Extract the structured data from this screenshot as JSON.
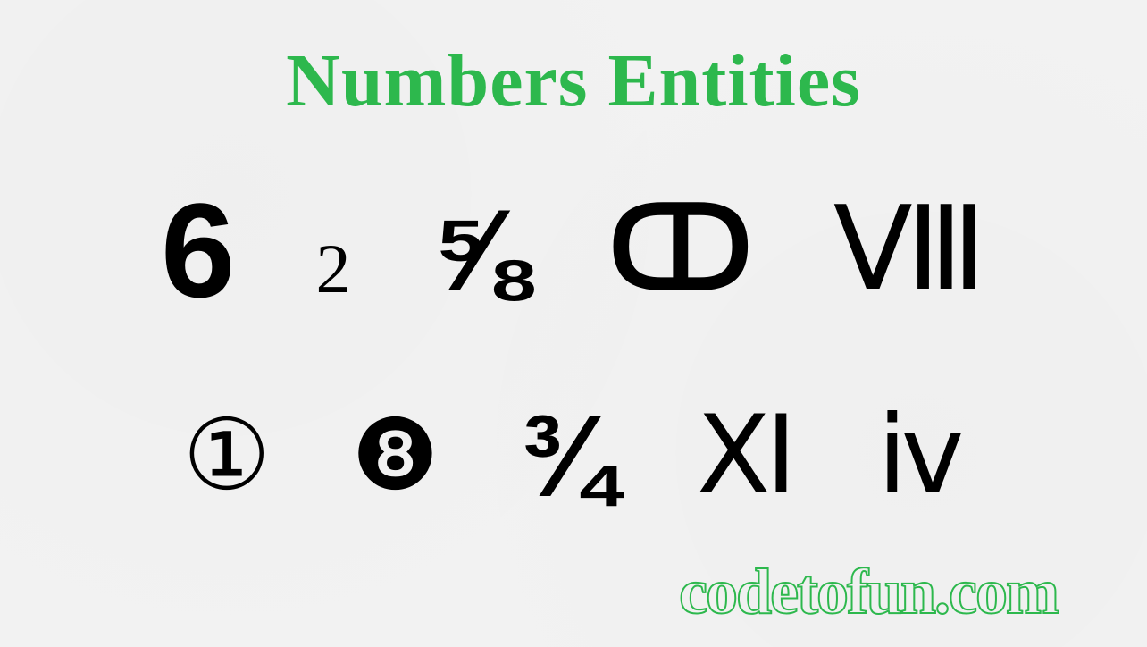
{
  "heading": "Numbers Entities",
  "row1": {
    "items": [
      {
        "value": "6",
        "style": "bold"
      },
      {
        "value": "2",
        "style": "serif-small"
      },
      {
        "value": "⅝",
        "style": "bold"
      },
      {
        "value": "ↀ",
        "style": "serif-bold"
      },
      {
        "value": "Ⅷ",
        "style": "serif"
      }
    ]
  },
  "row2": {
    "items": [
      {
        "value": "①",
        "style": "serif"
      },
      {
        "value": "❽",
        "style": "serif"
      },
      {
        "value": "¾",
        "style": "bold"
      },
      {
        "value": "Ⅺ",
        "style": "serif"
      },
      {
        "value": "ⅳ",
        "style": "serif"
      }
    ]
  },
  "watermark": "codetofun.com"
}
